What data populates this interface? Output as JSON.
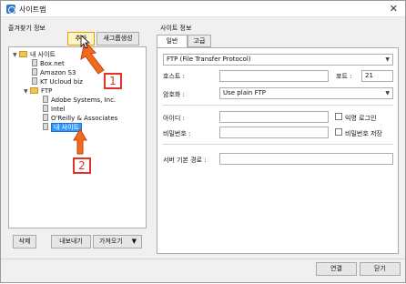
{
  "window": {
    "title": "사이트맵"
  },
  "left": {
    "group_label": "즐겨찾기 정보",
    "add_button": "추가",
    "new_folder_button": "새그룹생성",
    "tree": {
      "root_label": "내 사이트",
      "root_items": [
        "Box.net",
        "Amazon S3",
        "KT Ucloud biz"
      ],
      "ftp_label": "FTP",
      "ftp_items": [
        "Adobe Systems, Inc.",
        "Intel",
        "O'Reilly & Associates"
      ],
      "editing_item": "내 사이트"
    },
    "delete_button": "삭제",
    "export_button": "내보내기",
    "import_button": "가져오기"
  },
  "callouts": {
    "one": "1",
    "two": "2"
  },
  "right": {
    "group_label": "사이트 정보",
    "tabs": [
      "일반",
      "고급"
    ],
    "protocol_value": "FTP (File Transfer Protocol)",
    "host_label": "호스트 :",
    "host_value": "",
    "port_label": "포트 :",
    "port_value": "21",
    "encryption_label": "암호화 :",
    "encryption_value": "Use plain FTP",
    "id_label": "아이디 :",
    "anonymous_label": "익명 로그인",
    "password_label": "비밀번호 :",
    "save_password_label": "비밀번호 저장",
    "base_path_label": "서버 기본 경로 :"
  },
  "footer": {
    "connect_button": "연결",
    "close_button": "닫기"
  },
  "colors": {
    "accent": "#e2322a",
    "selection": "#3399ff"
  }
}
